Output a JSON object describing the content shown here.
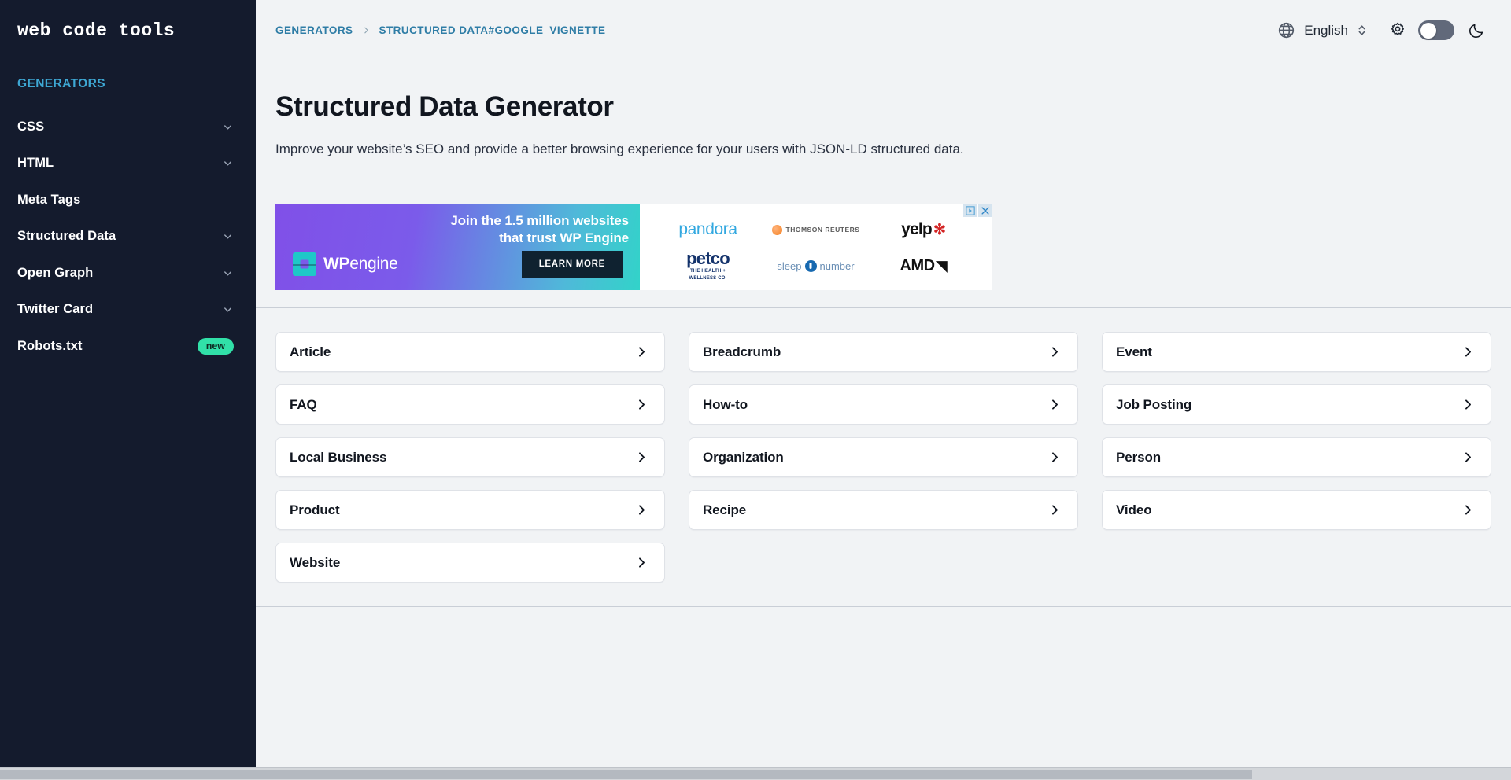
{
  "sidebar": {
    "brand": "web code tools",
    "section_title": "GENERATORS",
    "items": [
      {
        "label": "CSS",
        "icon": "chevron-down-icon",
        "expandable": true,
        "badge": ""
      },
      {
        "label": "HTML",
        "icon": "chevron-down-icon",
        "expandable": true,
        "badge": ""
      },
      {
        "label": "Meta Tags",
        "icon": "",
        "expandable": false,
        "badge": ""
      },
      {
        "label": "Structured Data",
        "icon": "chevron-down-icon",
        "expandable": true,
        "badge": ""
      },
      {
        "label": "Open Graph",
        "icon": "chevron-down-icon",
        "expandable": true,
        "badge": ""
      },
      {
        "label": "Twitter Card",
        "icon": "chevron-down-icon",
        "expandable": true,
        "badge": ""
      },
      {
        "label": "Robots.txt",
        "icon": "",
        "expandable": false,
        "badge": "new"
      }
    ],
    "colors": {
      "background": "#141b2d",
      "section_title": "#3ea8d4",
      "badge_bg": "#31e0a8"
    }
  },
  "header": {
    "breadcrumb": [
      {
        "label": "GENERATORS"
      },
      {
        "label": "STRUCTURED DATA#GOOGLE_VIGNETTE"
      }
    ],
    "separator_icon": "chevron-right-icon",
    "globe_icon": "globe-icon",
    "language": "English",
    "language_selector_icon": "chevron-up-down-icon",
    "settings_icon": "gear-icon",
    "theme_toggle": {
      "icon": "toggle-switch",
      "state": "off"
    },
    "dark_mode_icon": "moon-icon",
    "accent_color": "#2f7da6"
  },
  "page": {
    "title": "Structured Data Generator",
    "subtitle": "Improve your website’s SEO and provide a better browsing experience for your users with JSON-LD structured data."
  },
  "ad": {
    "headline_line1": "Join the 1.5 million websites",
    "headline_line2": "that trust WP Engine",
    "brand_bold": "WP",
    "brand_light": "engine",
    "brand_mark_icon": "wp-engine-logo-icon",
    "cta_label": "LEARN MORE",
    "adchoices_icon": "adchoices-icon",
    "close_icon": "close-icon",
    "logos": [
      {
        "name": "pandora",
        "text": "pandora"
      },
      {
        "name": "thomson-reuters",
        "text": "THOMSON REUTERS"
      },
      {
        "name": "yelp",
        "text": "yelp"
      },
      {
        "name": "petco",
        "text": "petco",
        "tagline_line1": "THE HEALTH +",
        "tagline_line2": "WELLNESS CO."
      },
      {
        "name": "sleep-number",
        "text_left": "sleep",
        "text_right": "number"
      },
      {
        "name": "amd",
        "text": "AMD"
      }
    ],
    "gradient_from": "#8050e8",
    "gradient_to": "#32d3c9"
  },
  "generators": {
    "chevron_icon": "chevron-right-icon",
    "cards": [
      {
        "label": "Article"
      },
      {
        "label": "Breadcrumb"
      },
      {
        "label": "Event"
      },
      {
        "label": "FAQ"
      },
      {
        "label": "How-to"
      },
      {
        "label": "Job Posting"
      },
      {
        "label": "Local Business"
      },
      {
        "label": "Organization"
      },
      {
        "label": "Person"
      },
      {
        "label": "Product"
      },
      {
        "label": "Recipe"
      },
      {
        "label": "Video"
      },
      {
        "label": "Website"
      }
    ]
  }
}
